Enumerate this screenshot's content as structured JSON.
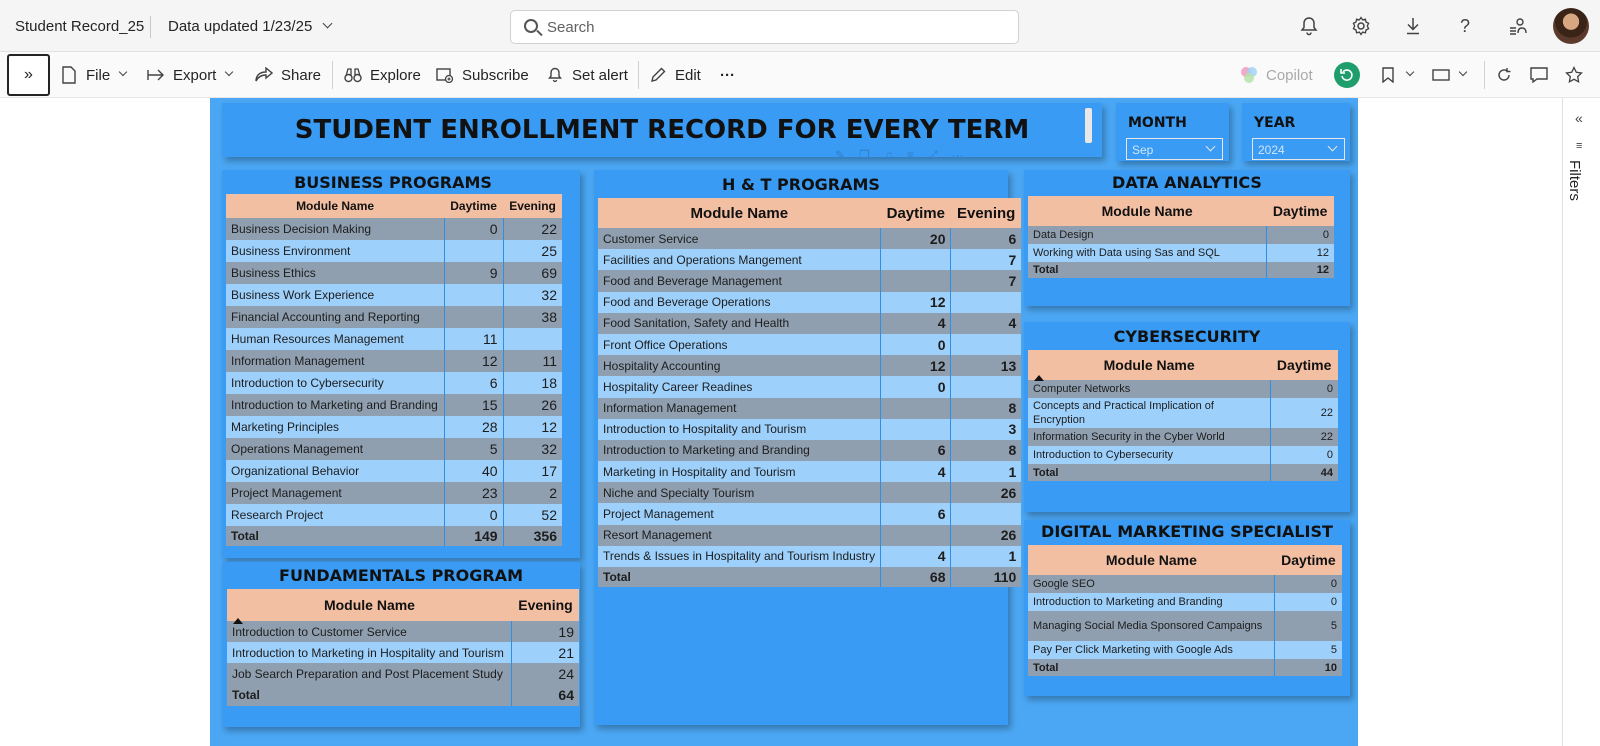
{
  "app": {
    "title": "Student Record_25",
    "data_updated": "Data updated 1/23/25",
    "search_placeholder": "Search"
  },
  "toolbar": {
    "file": "File",
    "export": "Export",
    "share": "Share",
    "explore": "Explore",
    "subscribe": "Subscribe",
    "set_alert": "Set alert",
    "edit": "Edit",
    "more": "···",
    "copilot": "Copilot"
  },
  "filters_label": "Filters",
  "report": {
    "title": "STUDENT ENROLLMENT RECORD FOR EVERY TERM",
    "month_label": "MONTH",
    "month_value": "Sep",
    "year_label": "YEAR",
    "year_value": "2024"
  },
  "business": {
    "title": "BUSINESS PROGRAMS",
    "headers": [
      "Module Name",
      "Daytime",
      "Evening"
    ],
    "rows": [
      [
        "Business Decision Making",
        "0",
        "22"
      ],
      [
        "Business Environment",
        "",
        "25"
      ],
      [
        "Business Ethics",
        "9",
        "69"
      ],
      [
        "Business Work Experience",
        "",
        "32"
      ],
      [
        "Financial Accounting and Reporting",
        "",
        "38"
      ],
      [
        "Human Resources Management",
        "11",
        ""
      ],
      [
        "Information Management",
        "12",
        "11"
      ],
      [
        "Introduction to Cybersecurity",
        "6",
        "18"
      ],
      [
        "Introduction to Marketing and Branding",
        "15",
        "26"
      ],
      [
        "Marketing Principles",
        "28",
        "12"
      ],
      [
        "Operations Management",
        "5",
        "32"
      ],
      [
        "Organizational Behavior",
        "40",
        "17"
      ],
      [
        "Project Management",
        "23",
        "2"
      ],
      [
        "Research Project",
        "0",
        "52"
      ]
    ],
    "total": [
      "Total",
      "149",
      "356"
    ]
  },
  "fundamentals": {
    "title": "FUNDAMENTALS PROGRAM",
    "headers": [
      "Module Name",
      "Evening"
    ],
    "rows": [
      [
        "Introduction to Customer Service",
        "19"
      ],
      [
        "Introduction to Marketing in Hospitality and Tourism",
        "21"
      ],
      [
        "Job Search Preparation and Post Placement Study",
        "24"
      ]
    ],
    "total": [
      "Total",
      "64"
    ]
  },
  "ht": {
    "title": "H & T PROGRAMS",
    "headers": [
      "Module Name",
      "Daytime",
      "Evening"
    ],
    "rows": [
      [
        "Customer Service",
        "20",
        "6"
      ],
      [
        "Facilities and Operations Mangement",
        "",
        "7"
      ],
      [
        "Food and Beverage Management",
        "",
        "7"
      ],
      [
        "Food and Beverage Operations",
        "12",
        ""
      ],
      [
        "Food Sanitation, Safety and Health",
        "4",
        "4"
      ],
      [
        "Front Office Operations",
        "0",
        ""
      ],
      [
        "Hospitality Accounting",
        "12",
        "13"
      ],
      [
        "Hospitality Career Readines",
        "0",
        ""
      ],
      [
        "Information Management",
        "",
        "8"
      ],
      [
        "Introduction to Hospitality and Tourism",
        "",
        "3"
      ],
      [
        "Introduction to Marketing and Branding",
        "6",
        "8"
      ],
      [
        "Marketing in Hospitality and Tourism",
        "4",
        "1"
      ],
      [
        "Niche and Specialty Tourism",
        "",
        "26"
      ],
      [
        "Project Management",
        "6",
        ""
      ],
      [
        "Resort Management",
        "",
        "26"
      ],
      [
        "Trends & Issues in Hospitality and Tourism Industry",
        "4",
        "1"
      ]
    ],
    "total": [
      "Total",
      "68",
      "110"
    ]
  },
  "data_analytics": {
    "title": "DATA ANALYTICS",
    "headers": [
      "Module Name",
      "Daytime"
    ],
    "rows": [
      [
        "Data Design",
        "0"
      ],
      [
        "Working with Data using Sas and SQL",
        "12"
      ]
    ],
    "total": [
      "Total",
      "12"
    ]
  },
  "cybersecurity": {
    "title": "CYBERSECURITY",
    "headers": [
      "Module Name",
      "Daytime"
    ],
    "rows": [
      [
        "Computer Networks",
        "0"
      ],
      [
        "Concepts and Practical Implication of Encryption",
        "22"
      ],
      [
        "Information Security in the Cyber World",
        "22"
      ],
      [
        "Introduction to Cybersecurity",
        "0"
      ]
    ],
    "total": [
      "Total",
      "44"
    ]
  },
  "digital_marketing": {
    "title": "DIGITAL MARKETING SPECIALIST",
    "headers": [
      "Module Name",
      "Daytime"
    ],
    "rows": [
      [
        "Google SEO",
        "0"
      ],
      [
        "Introduction to Marketing and Branding",
        "0"
      ],
      [
        "Managing Social Media Sponsored Campaigns",
        "5"
      ],
      [
        "Pay Per Click Marketing with Google Ads",
        "5"
      ]
    ],
    "total": [
      "Total",
      "10"
    ]
  },
  "colors": {
    "canvas": "#4ba7f4",
    "panel": "#399bf3",
    "header_row": "#f3bfa3",
    "row_dark": "#8f9fb0",
    "row_light": "#9dd0fb"
  },
  "icons": [
    "bell-icon",
    "gear-icon",
    "download-icon",
    "help-icon",
    "people-icon",
    "document-icon",
    "export-icon",
    "share-icon",
    "binoculars-icon",
    "subscribe-icon",
    "alert-bell-icon",
    "pencil-icon",
    "refresh-icon",
    "bookmark-icon",
    "view-icon",
    "comment-icon",
    "star-icon"
  ]
}
